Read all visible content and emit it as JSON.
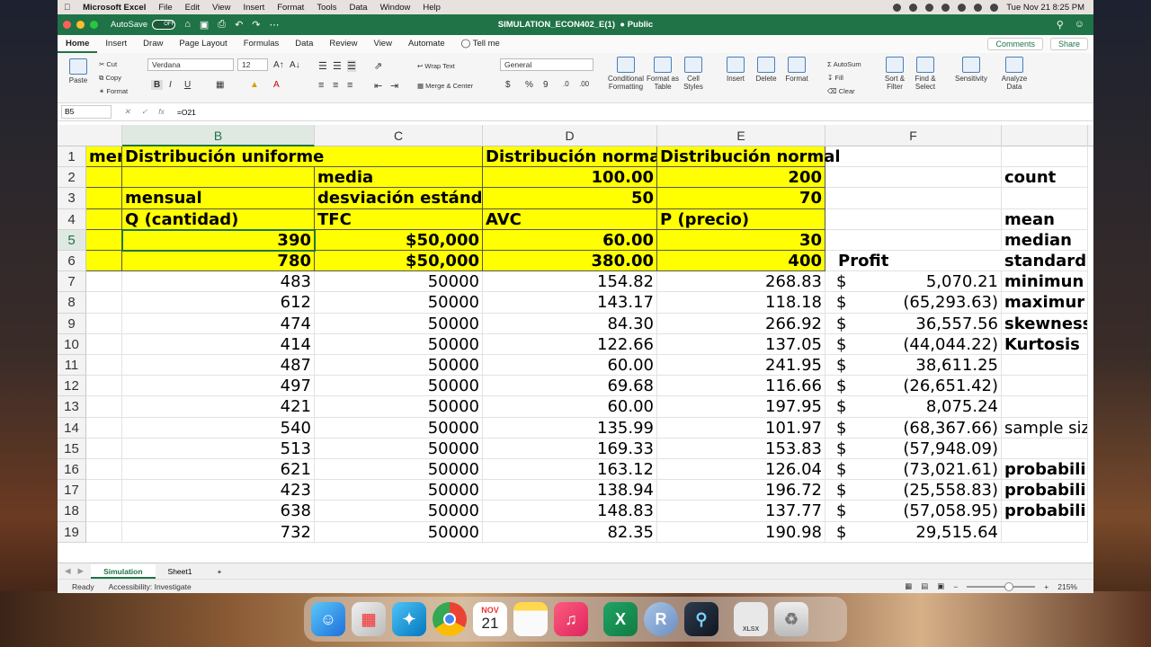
{
  "menubar": {
    "app_name": "Microsoft Excel",
    "items": [
      "File",
      "Edit",
      "View",
      "Insert",
      "Format",
      "Tools",
      "Data",
      "Window",
      "Help"
    ],
    "datetime": "Tue Nov 21  8:25 PM"
  },
  "titlebar": {
    "autosave_label": "AutoSave",
    "autosave_state": "OFF",
    "document_title": "SIMULATION_ECON402_E(1)",
    "visibility": "Public",
    "accent_color": "#207346"
  },
  "tabs": [
    "Home",
    "Insert",
    "Draw",
    "Page Layout",
    "Formulas",
    "Data",
    "Review",
    "View",
    "Automate"
  ],
  "tell_me": "Tell me",
  "comments_label": "Comments",
  "share_label": "Share",
  "ribbon": {
    "paste": "Paste",
    "cut": "Cut",
    "copy": "Copy",
    "format_painter": "Format",
    "font_name": "Verdana",
    "font_size": "12",
    "wrap_text": "Wrap Text",
    "merge_center": "Merge & Center",
    "number_format": "General",
    "conditional_formatting": "Conditional Formatting",
    "format_as_table": "Format as Table",
    "cell_styles": "Cell Styles",
    "insert": "Insert",
    "delete": "Delete",
    "format": "Format",
    "autosum": "AutoSum",
    "fill": "Fill",
    "clear": "Clear",
    "sort_filter": "Sort & Filter",
    "find_select": "Find & Select",
    "sensitivity": "Sensitivity",
    "analyze_data": "Analyze Data"
  },
  "formula_bar": {
    "name_box": "B5",
    "formula": "=O21"
  },
  "columns": [
    {
      "key": "A",
      "label": ""
    },
    {
      "key": "B",
      "label": "B"
    },
    {
      "key": "C",
      "label": "C"
    },
    {
      "key": "D",
      "label": "D"
    },
    {
      "key": "E",
      "label": "E"
    },
    {
      "key": "F",
      "label": "F"
    },
    {
      "key": "G",
      "label": ""
    }
  ],
  "rows": [
    {
      "n": "1",
      "A": "mens",
      "B": "Distribución uniforme",
      "C": "",
      "D": "Distribución norma",
      "E": "Distribución normal",
      "F1": "",
      "F2": "",
      "G": ""
    },
    {
      "n": "2",
      "A": "",
      "B": "",
      "C": "media",
      "D": "100.00",
      "E": "200",
      "F1": "",
      "F2": "",
      "G": "count"
    },
    {
      "n": "3",
      "A": "",
      "B": "mensual",
      "C": "desviación estánda",
      "D": "50",
      "E": "70",
      "F1": "",
      "F2": "",
      "G": ""
    },
    {
      "n": "4",
      "A": "",
      "B": "Q (cantidad)",
      "C": "TFC",
      "D": "AVC",
      "E": "P (precio)",
      "F1": "",
      "F2": "",
      "G": "mean"
    },
    {
      "n": "5",
      "A": "",
      "B": "390",
      "C": "$50,000",
      "D": "60.00",
      "E": "30",
      "F1": "",
      "F2": "",
      "G": "median"
    },
    {
      "n": "6",
      "A": "",
      "B": "780",
      "C": "$50,000",
      "D": "380.00",
      "E": "400",
      "F1": "Profit",
      "F2": "",
      "G": "standard"
    },
    {
      "n": "7",
      "A": "",
      "B": "483",
      "C": "50000",
      "D": "154.82",
      "E": "268.83",
      "F1": "$",
      "F2": "5,070.21",
      "G": "minimun"
    },
    {
      "n": "8",
      "A": "",
      "B": "612",
      "C": "50000",
      "D": "143.17",
      "E": "118.18",
      "F1": "$",
      "F2": "(65,293.63)",
      "G": "maximur"
    },
    {
      "n": "9",
      "A": "",
      "B": "474",
      "C": "50000",
      "D": "84.30",
      "E": "266.92",
      "F1": "$",
      "F2": "36,557.56",
      "G": "skewness"
    },
    {
      "n": "10",
      "A": "",
      "B": "414",
      "C": "50000",
      "D": "122.66",
      "E": "137.05",
      "F1": "$",
      "F2": "(44,044.22)",
      "G": "Kurtosis"
    },
    {
      "n": "11",
      "A": "",
      "B": "487",
      "C": "50000",
      "D": "60.00",
      "E": "241.95",
      "F1": "$",
      "F2": "38,611.25",
      "G": ""
    },
    {
      "n": "12",
      "A": "",
      "B": "497",
      "C": "50000",
      "D": "69.68",
      "E": "116.66",
      "F1": "$",
      "F2": "(26,651.42)",
      "G": ""
    },
    {
      "n": "13",
      "A": "",
      "B": "421",
      "C": "50000",
      "D": "60.00",
      "E": "197.95",
      "F1": "$",
      "F2": "8,075.24",
      "G": ""
    },
    {
      "n": "14",
      "A": "",
      "B": "540",
      "C": "50000",
      "D": "135.99",
      "E": "101.97",
      "F1": "$",
      "F2": "(68,367.66)",
      "G": "sample siz"
    },
    {
      "n": "15",
      "A": "",
      "B": "513",
      "C": "50000",
      "D": "169.33",
      "E": "153.83",
      "F1": "$",
      "F2": "(57,948.09)",
      "G": ""
    },
    {
      "n": "16",
      "A": "",
      "B": "621",
      "C": "50000",
      "D": "163.12",
      "E": "126.04",
      "F1": "$",
      "F2": "(73,021.61)",
      "G": "probabili"
    },
    {
      "n": "17",
      "A": "",
      "B": "423",
      "C": "50000",
      "D": "138.94",
      "E": "196.72",
      "F1": "$",
      "F2": "(25,558.83)",
      "G": "probabili"
    },
    {
      "n": "18",
      "A": "",
      "B": "638",
      "C": "50000",
      "D": "148.83",
      "E": "137.77",
      "F1": "$",
      "F2": "(57,058.95)",
      "G": "probabili"
    },
    {
      "n": "19",
      "A": "",
      "B": "732",
      "C": "50000",
      "D": "82.35",
      "E": "190.98",
      "F1": "$",
      "F2": "29,515.64",
      "G": ""
    }
  ],
  "sheets": [
    "Simulation",
    "Sheet1"
  ],
  "add_sheet": "+",
  "status": {
    "ready": "Ready",
    "accessibility": "Accessibility: Investigate",
    "zoom": "215%"
  },
  "dock": {
    "calendar_month": "NOV",
    "calendar_day": "21",
    "xlsx_label": "XLSX"
  }
}
